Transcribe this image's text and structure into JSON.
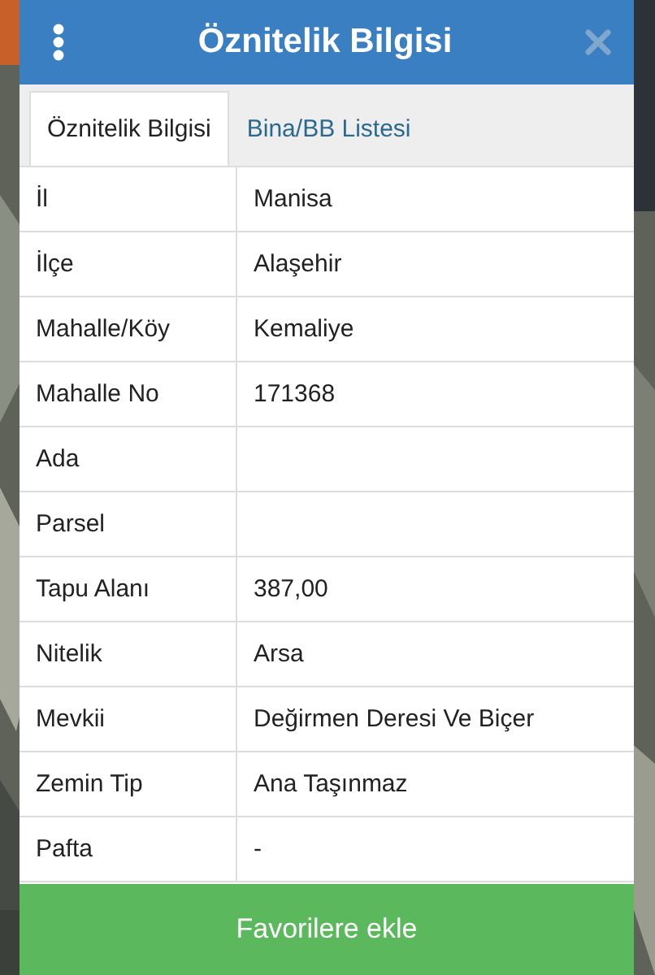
{
  "dialog": {
    "title": "Öznitelik Bilgisi"
  },
  "tabs": [
    {
      "label": "Öznitelik Bilgisi",
      "selected": true
    },
    {
      "label": "Bina/BB Listesi",
      "selected": false
    }
  ],
  "rows": [
    {
      "label": "İl",
      "value": "Manisa"
    },
    {
      "label": "İlçe",
      "value": "Alaşehir"
    },
    {
      "label": "Mahalle/Köy",
      "value": "Kemaliye"
    },
    {
      "label": "Mahalle No",
      "value": "171368"
    },
    {
      "label": "Ada"
    },
    {
      "label": "Parsel"
    },
    {
      "label": "Tapu Alanı",
      "value": "387,00"
    },
    {
      "label": "Nitelik",
      "value": "Arsa"
    },
    {
      "label": "Mevkii",
      "value": "Değirmen Deresi Ve Biçer"
    },
    {
      "label": "Zemin Tip",
      "value": "Ana Taşınmaz"
    },
    {
      "label": "Pafta",
      "value": "-"
    }
  ],
  "action_button": "Favorilere ekle"
}
